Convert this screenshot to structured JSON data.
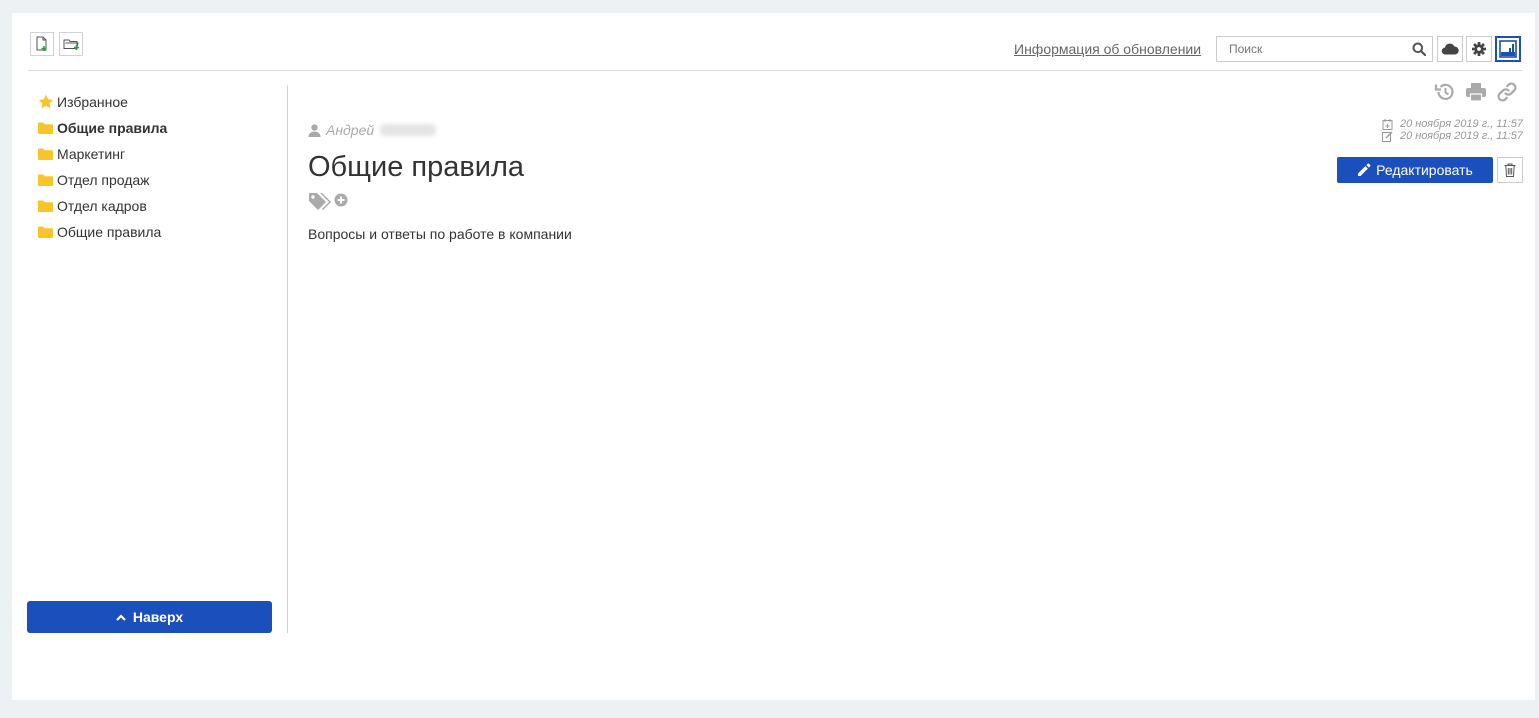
{
  "header": {
    "update_link": "Информация об обновлении",
    "search": {
      "placeholder": "Поиск",
      "value": ""
    },
    "icons": [
      "new-document-icon",
      "new-folder-icon",
      "search-icon",
      "cloud-icon",
      "gear-icon",
      "view-mode-icon"
    ]
  },
  "sidebar": {
    "items": [
      {
        "label": "Избранное",
        "icon": "star-icon",
        "active": false
      },
      {
        "label": "Общие правила",
        "icon": "folder-icon",
        "active": true
      },
      {
        "label": "Маркетинг",
        "icon": "folder-icon",
        "active": false
      },
      {
        "label": "Отдел продаж",
        "icon": "folder-icon",
        "active": false
      },
      {
        "label": "Отдел кадров",
        "icon": "folder-icon",
        "active": false
      },
      {
        "label": "Общие правила",
        "icon": "folder-icon",
        "active": false
      }
    ],
    "up_button": "Наверх"
  },
  "article": {
    "author": "Андрей",
    "created": "20 ноября 2019 г., 11:57",
    "modified": "20 ноября 2019 г., 11:57",
    "title": "Общие правила",
    "edit_button": "Редактировать",
    "description": "Вопросы и ответы по работе в компании",
    "action_icons": [
      "history-icon",
      "print-icon",
      "link-icon"
    ]
  },
  "colors": {
    "accent": "#1b4fbb",
    "folder": "#f7c52a",
    "star": "#f7c52a",
    "muted": "#aaaaaa"
  }
}
